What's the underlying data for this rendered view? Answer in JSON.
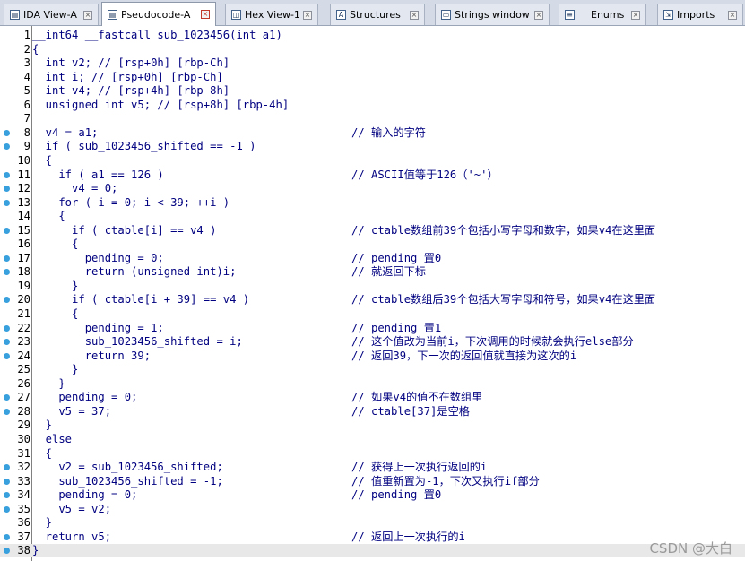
{
  "tabs": [
    {
      "label": "IDA View-A",
      "icon": "ida-view-icon",
      "active": false
    },
    {
      "label": "Pseudocode-A",
      "icon": "pseudocode-icon",
      "active": true
    },
    {
      "label": "Hex View-1",
      "icon": "hex-view-icon",
      "active": false
    },
    {
      "label": "Structures",
      "icon": "structures-icon",
      "active": false
    },
    {
      "label": "Strings window",
      "icon": "strings-icon",
      "active": false
    },
    {
      "label": "Enums",
      "icon": "enums-icon",
      "active": false
    },
    {
      "label": "Imports",
      "icon": "imports-icon",
      "active": false
    }
  ],
  "code_lines": [
    {
      "n": "1",
      "dot": false,
      "code": "__int64 __fastcall sub_1023456(int a1)",
      "comment": ""
    },
    {
      "n": "2",
      "dot": false,
      "code": "{",
      "comment": ""
    },
    {
      "n": "3",
      "dot": false,
      "code": "  int v2; // [rsp+0h] [rbp-Ch]",
      "comment": ""
    },
    {
      "n": "4",
      "dot": false,
      "code": "  int i; // [rsp+0h] [rbp-Ch]",
      "comment": ""
    },
    {
      "n": "5",
      "dot": false,
      "code": "  int v4; // [rsp+4h] [rbp-8h]",
      "comment": ""
    },
    {
      "n": "6",
      "dot": false,
      "code": "  unsigned int v5; // [rsp+8h] [rbp-4h]",
      "comment": ""
    },
    {
      "n": "7",
      "dot": false,
      "code": "",
      "comment": ""
    },
    {
      "n": "8",
      "dot": true,
      "code": "  v4 = a1;",
      "comment": "// 输入的字符"
    },
    {
      "n": "9",
      "dot": true,
      "code": "  if ( sub_1023456_shifted == -1 )",
      "comment": ""
    },
    {
      "n": "10",
      "dot": false,
      "code": "  {",
      "comment": ""
    },
    {
      "n": "11",
      "dot": true,
      "code": "    if ( a1 == 126 )",
      "comment": "// ASCII值等于126（'~'）"
    },
    {
      "n": "12",
      "dot": true,
      "code": "      v4 = 0;",
      "comment": ""
    },
    {
      "n": "13",
      "dot": true,
      "code": "    for ( i = 0; i < 39; ++i )",
      "comment": ""
    },
    {
      "n": "14",
      "dot": false,
      "code": "    {",
      "comment": ""
    },
    {
      "n": "15",
      "dot": true,
      "code": "      if ( ctable[i] == v4 )",
      "comment": "// ctable数组前39个包括小写字母和数字，如果v4在这里面"
    },
    {
      "n": "16",
      "dot": false,
      "code": "      {",
      "comment": ""
    },
    {
      "n": "17",
      "dot": true,
      "code": "        pending = 0;",
      "comment": "// pending 置0"
    },
    {
      "n": "18",
      "dot": true,
      "code": "        return (unsigned int)i;",
      "comment": "// 就返回下标"
    },
    {
      "n": "19",
      "dot": false,
      "code": "      }",
      "comment": ""
    },
    {
      "n": "20",
      "dot": true,
      "code": "      if ( ctable[i + 39] == v4 )",
      "comment": "// ctable数组后39个包括大写字母和符号，如果v4在这里面"
    },
    {
      "n": "21",
      "dot": false,
      "code": "      {",
      "comment": ""
    },
    {
      "n": "22",
      "dot": true,
      "code": "        pending = 1;",
      "comment": "// pending 置1"
    },
    {
      "n": "23",
      "dot": true,
      "code": "        sub_1023456_shifted = i;",
      "comment": "// 这个值改为当前i，下次调用的时候就会执行else部分"
    },
    {
      "n": "24",
      "dot": true,
      "code": "        return 39;",
      "comment": "// 返回39，下一次的返回值就直接为这次的i"
    },
    {
      "n": "25",
      "dot": false,
      "code": "      }",
      "comment": ""
    },
    {
      "n": "26",
      "dot": false,
      "code": "    }",
      "comment": ""
    },
    {
      "n": "27",
      "dot": true,
      "code": "    pending = 0;",
      "comment": "// 如果v4的值不在数组里"
    },
    {
      "n": "28",
      "dot": true,
      "code": "    v5 = 37;",
      "comment": "// ctable[37]是空格"
    },
    {
      "n": "29",
      "dot": false,
      "code": "  }",
      "comment": ""
    },
    {
      "n": "30",
      "dot": false,
      "code": "  else",
      "comment": ""
    },
    {
      "n": "31",
      "dot": false,
      "code": "  {",
      "comment": ""
    },
    {
      "n": "32",
      "dot": true,
      "code": "    v2 = sub_1023456_shifted;",
      "comment": "// 获得上一次执行返回的i"
    },
    {
      "n": "33",
      "dot": true,
      "code": "    sub_1023456_shifted = -1;",
      "comment": "// 值重新置为-1，下次又执行if部分"
    },
    {
      "n": "34",
      "dot": true,
      "code": "    pending = 0;",
      "comment": "// pending 置0"
    },
    {
      "n": "35",
      "dot": true,
      "code": "    v5 = v2;",
      "comment": ""
    },
    {
      "n": "36",
      "dot": false,
      "code": "  }",
      "comment": ""
    },
    {
      "n": "37",
      "dot": true,
      "code": "  return v5;",
      "comment": "// 返回上一次执行的i"
    },
    {
      "n": "38",
      "dot": true,
      "code": "}",
      "comment": ""
    }
  ],
  "watermark": "CSDN @大白",
  "colors": {
    "code": "#000080",
    "dot": "#39a0de",
    "tab_bar": "#d4dbe6"
  }
}
